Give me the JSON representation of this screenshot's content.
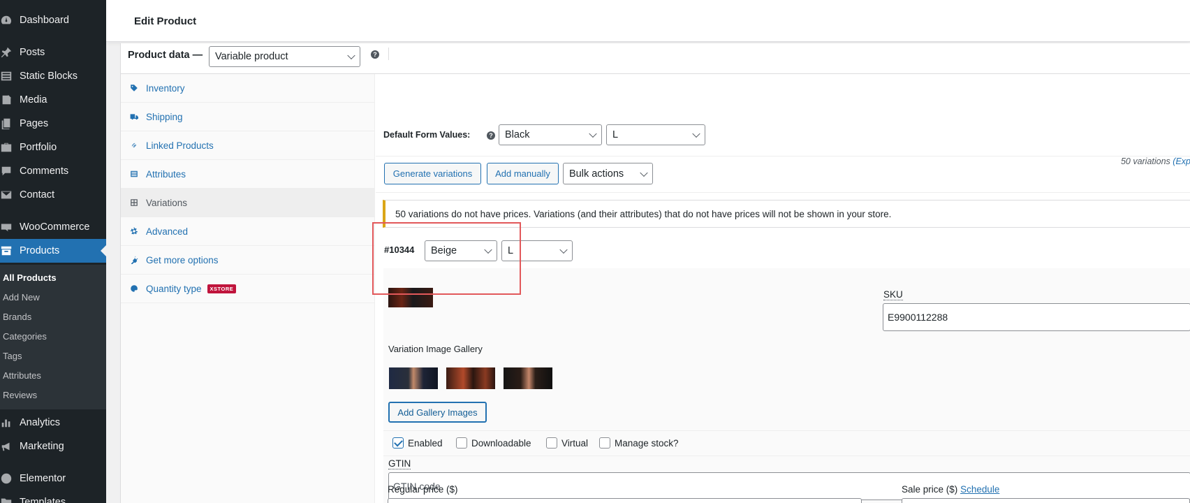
{
  "sidebar": {
    "menu": [
      {
        "label": "Dashboard",
        "icon": "dashboard-icon"
      },
      {
        "label": "Posts",
        "icon": "pin-icon"
      },
      {
        "label": "Static Blocks",
        "icon": "blocks-icon"
      },
      {
        "label": "Media",
        "icon": "media-icon"
      },
      {
        "label": "Pages",
        "icon": "pages-icon"
      },
      {
        "label": "Portfolio",
        "icon": "portfolio-icon"
      },
      {
        "label": "Comments",
        "icon": "comments-icon"
      },
      {
        "label": "Contact",
        "icon": "mail-icon"
      },
      {
        "label": "WooCommerce",
        "icon": "woo-icon"
      },
      {
        "label": "Products",
        "icon": "archive-icon"
      },
      {
        "label": "Analytics",
        "icon": "bar-chart-icon"
      },
      {
        "label": "Marketing",
        "icon": "megaphone-icon"
      },
      {
        "label": "Elementor",
        "icon": "elementor-icon"
      },
      {
        "label": "Templates",
        "icon": "folder-icon"
      }
    ],
    "submenu": [
      "All Products",
      "Add New",
      "Brands",
      "Categories",
      "Tags",
      "Attributes",
      "Reviews"
    ],
    "active_color": "#2271b1"
  },
  "header": {
    "title": "Edit Product"
  },
  "product_data": {
    "label": "Product data —",
    "type_value": "Variable product",
    "tabs": [
      {
        "label": "Inventory",
        "icon": "tag-icon"
      },
      {
        "label": "Shipping",
        "icon": "truck-icon"
      },
      {
        "label": "Linked Products",
        "icon": "link-icon"
      },
      {
        "label": "Attributes",
        "icon": "list-icon"
      },
      {
        "label": "Variations",
        "icon": "grid-icon"
      },
      {
        "label": "Advanced",
        "icon": "gear-icon"
      },
      {
        "label": "Get more options",
        "icon": "plugin-icon"
      },
      {
        "label": "Quantity type",
        "icon": "palette-icon",
        "badge": "XSTORE"
      }
    ]
  },
  "variations": {
    "default_form_label": "Default Form Values:",
    "default_color": "Black",
    "default_size": "L",
    "generate_button": "Generate variations",
    "add_manually_button": "Add manually",
    "bulk_actions": "Bulk actions",
    "count_text": "50 variations",
    "expand_link": "(Exp",
    "notice": "50 variations do not have prices. Variations (and their attributes) that do not have prices will not be shown in your store.",
    "variation": {
      "id": "#10344",
      "color": "Beige",
      "size": "L",
      "sku_label": "SKU",
      "sku_value": "E9900112288",
      "gallery_label": "Variation Image Gallery",
      "add_gallery_button": "Add Gallery Images",
      "checkboxes": [
        {
          "label": "Enabled",
          "checked": true
        },
        {
          "label": "Downloadable",
          "checked": false
        },
        {
          "label": "Virtual",
          "checked": false
        },
        {
          "label": "Manage stock?",
          "checked": false
        }
      ],
      "gtin_label": "GTIN",
      "gtin_placeholder": "GTIN code",
      "regular_price_label": "Regular price ($)",
      "sale_price_label": "Sale price ($)",
      "schedule_link": "Schedule"
    }
  }
}
